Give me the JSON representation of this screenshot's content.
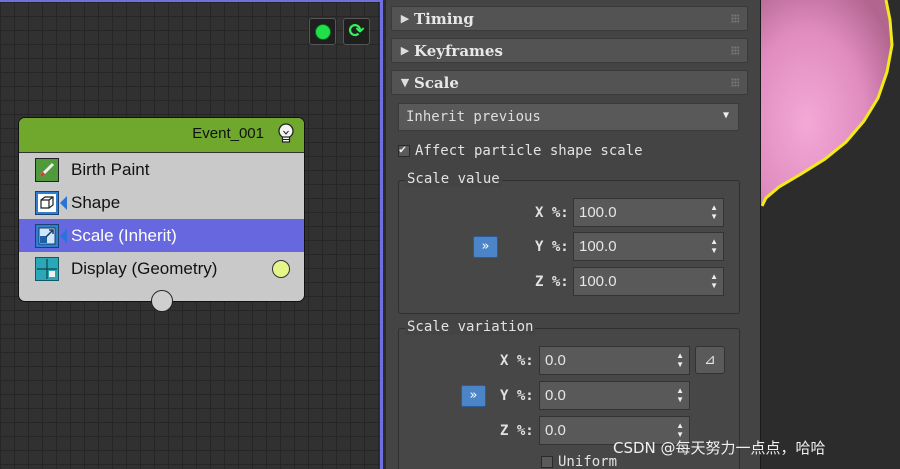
{
  "colors": {
    "event_header": "#6fa82c",
    "selection": "#6767e0",
    "editor_border": "#6f6fe0",
    "button_blue": "#4c84c8",
    "sphere_pink": "#e18fc2",
    "selection_outline": "#f2ea1a"
  },
  "editor": {
    "toolbar": [
      {
        "name": "green-dot-button",
        "icon": "green-dot-icon"
      },
      {
        "name": "refresh-button",
        "icon": "refresh-icon"
      }
    ],
    "event": {
      "title": "Event_001",
      "icon": "lightbulb-icon",
      "operators": [
        {
          "label": "Birth Paint",
          "icon": "paint-brush-icon",
          "selected": false
        },
        {
          "label": "Shape",
          "icon": "cube-icon",
          "selected": false
        },
        {
          "label": "Scale (Inherit)",
          "icon": "scale-icon",
          "selected": true
        },
        {
          "label": "Display (Geometry)",
          "icon": "display-grid-icon",
          "selected": false
        }
      ]
    }
  },
  "panel": {
    "rollouts": [
      {
        "label": "Timing",
        "expanded": false
      },
      {
        "label": "Keyframes",
        "expanded": false
      },
      {
        "label": "Scale",
        "expanded": true
      }
    ],
    "scale": {
      "inherit_select": "Inherit previous",
      "affect_label": "Affect particle shape scale",
      "affect_checked": true,
      "value_group": {
        "label": "Scale value",
        "x_label": "X %:",
        "x_value": "100.0",
        "y_label": "Y %:",
        "y_value": "100.0",
        "z_label": "Z %:",
        "z_value": "100.0",
        "expand_button": "»"
      },
      "variation_group": {
        "label": "Scale variation",
        "x_label": "X %:",
        "x_value": "0.0",
        "y_label": "Y %:",
        "y_value": "0.0",
        "z_label": "Z %:",
        "z_value": "0.0",
        "expand_button": "»",
        "uniform_toggle": "⊿",
        "uniform_label": "Uniform"
      }
    }
  },
  "watermark": "CSDN @每天努力一点点，哈哈"
}
